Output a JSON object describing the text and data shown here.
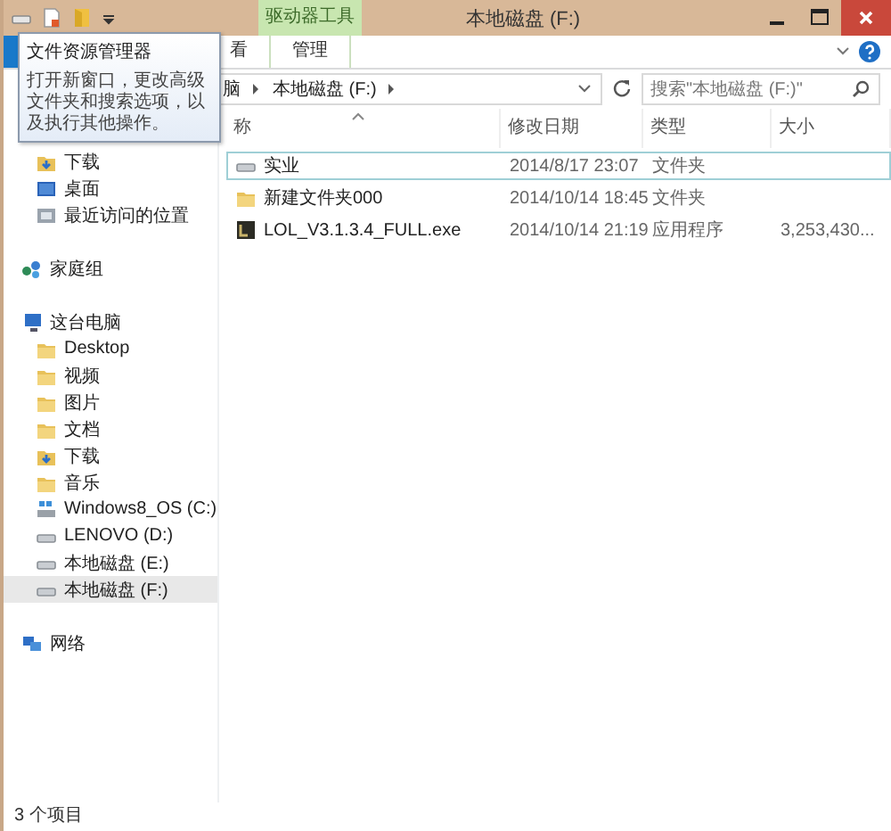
{
  "window": {
    "title": "本地磁盘 (F:)",
    "context_tab": "驱动器工具"
  },
  "ribbon_tabs": [
    {
      "label": "看"
    },
    {
      "label": "管理"
    }
  ],
  "address": {
    "path": [
      "脑",
      "本地磁盘 (F:)"
    ]
  },
  "search": {
    "placeholder": "搜索\"本地磁盘 (F:)\""
  },
  "columns": [
    "称",
    "修改日期",
    "类型",
    "大小"
  ],
  "rows": [
    {
      "kind": "drive",
      "name": "实业",
      "date": "2014/8/17 23:07",
      "type": "文件夹",
      "focused": true
    },
    {
      "kind": "folder",
      "name": "新建文件夹000",
      "date": "2014/10/14 18:45",
      "type": "文件夹",
      "focused": false
    },
    {
      "kind": "app",
      "name": "LOL_V3.1.3.4_FULL.exe",
      "date": "2014/10/14 21:19",
      "type": "应用程序",
      "size": "3,253,430...",
      "focused": false
    }
  ],
  "sidebar": [
    {
      "children": [
        {
          "kind": "download",
          "label": "下载",
          "selected": false
        },
        {
          "kind": "desktop",
          "label": "桌面",
          "selected": false
        },
        {
          "kind": "recent",
          "label": "最近访问的位置",
          "selected": false
        }
      ]
    },
    {
      "kind": "homegroup",
      "label": "家庭组"
    },
    {
      "kind": "pc",
      "label": "这台电脑",
      "children": [
        {
          "kind": "folder",
          "label": "Desktop",
          "selected": false
        },
        {
          "kind": "folder",
          "label": "视频",
          "selected": false
        },
        {
          "kind": "folder",
          "label": "图片",
          "selected": false
        },
        {
          "kind": "folder",
          "label": "文档",
          "selected": false
        },
        {
          "kind": "download",
          "label": "下载",
          "selected": false
        },
        {
          "kind": "folder",
          "label": "音乐",
          "selected": false
        },
        {
          "kind": "osdrive",
          "label": "Windows8_OS (C:)",
          "selected": false
        },
        {
          "kind": "drive",
          "label": "LENOVO (D:)",
          "selected": false
        },
        {
          "kind": "drive",
          "label": "本地磁盘 (E:)",
          "selected": false
        },
        {
          "kind": "drive",
          "label": "本地磁盘 (F:)",
          "selected": true
        }
      ]
    },
    {
      "kind": "network",
      "label": "网络"
    }
  ],
  "status_bar": "3 个项目",
  "tooltip": {
    "title": "文件资源管理器",
    "text": "打开新窗口，更改高级文件夹和搜索选项，以及执行其他操作。"
  }
}
